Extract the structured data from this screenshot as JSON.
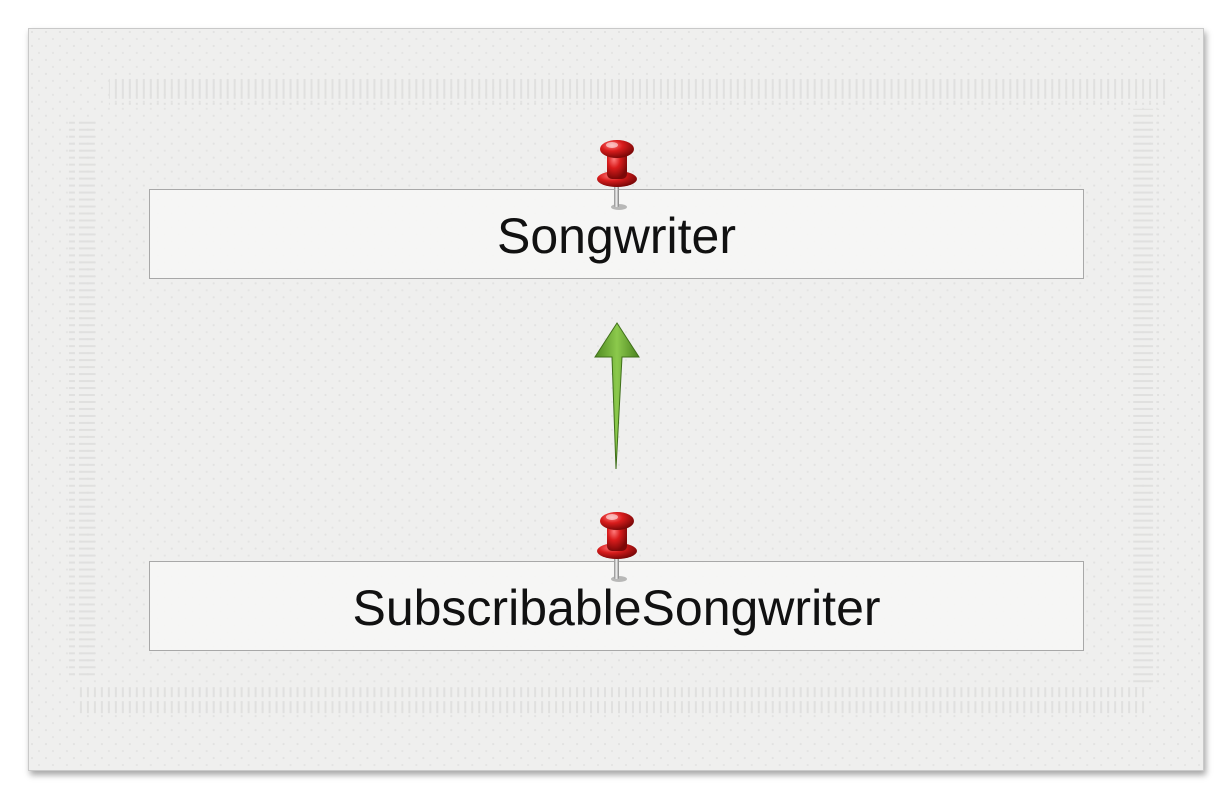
{
  "diagram": {
    "nodes": [
      {
        "id": "songwriter",
        "label": "Songwriter",
        "pin_icon": "pushpin-icon"
      },
      {
        "id": "subscribable-songwriter",
        "label": "SubscribableSongwriter",
        "pin_icon": "pushpin-icon"
      }
    ],
    "edges": [
      {
        "from": "subscribable-songwriter",
        "to": "songwriter",
        "kind": "inheritance-arrow"
      }
    ]
  },
  "colors": {
    "arrow": "#6aa832",
    "pin": "#d42020",
    "box_border": "#a8a8a8",
    "card_background": "#efefee"
  }
}
